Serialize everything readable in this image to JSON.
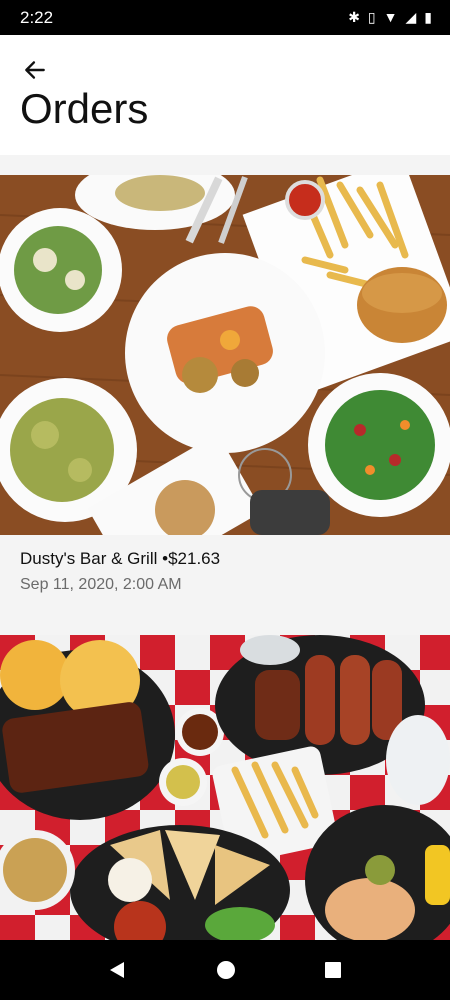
{
  "status_bar": {
    "time": "2:22",
    "icons": [
      "bluetooth-icon",
      "vibrate-icon",
      "wifi-icon",
      "signal-icon",
      "battery-icon"
    ]
  },
  "header": {
    "title": "Orders",
    "back_icon": "arrow-left-icon"
  },
  "orders": [
    {
      "restaurant": "Dusty's Bar & Grill",
      "separator": "•",
      "total": "$21.63",
      "date": "Sep 11, 2020, 2:00 AM"
    },
    {
      "restaurant": "",
      "total": "",
      "date": ""
    }
  ],
  "nav_bar": {
    "buttons": [
      "back-triangle-icon",
      "home-circle-icon",
      "recents-square-icon"
    ]
  }
}
